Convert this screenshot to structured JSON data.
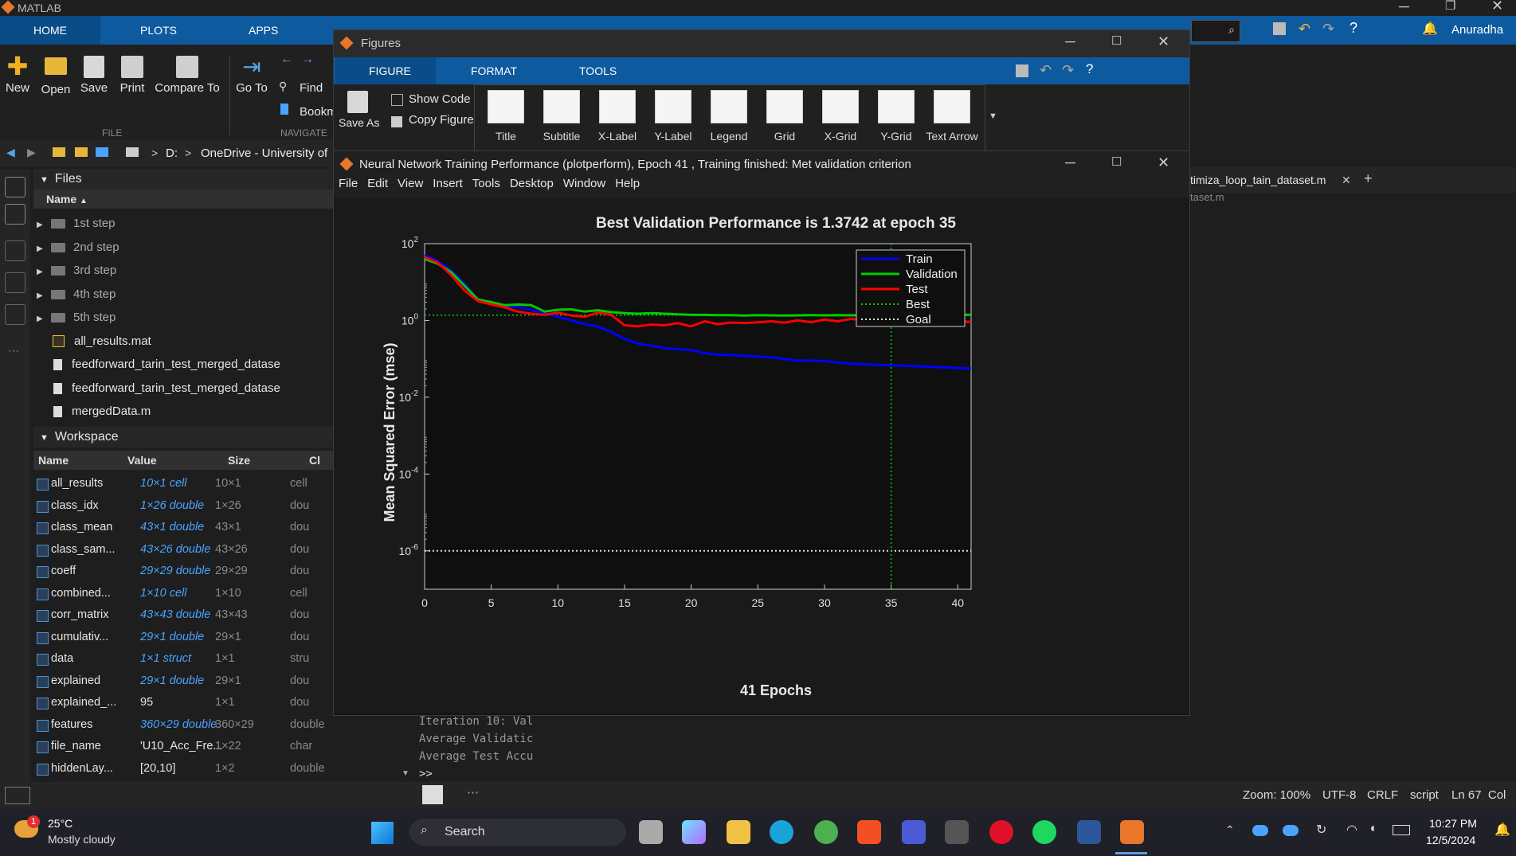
{
  "app_title": "MATLAB",
  "main_tabs": [
    "HOME",
    "PLOTS",
    "APPS"
  ],
  "user": "Anuradha",
  "toolstrip": {
    "file_buttons": [
      "New",
      "Open",
      "Save",
      "Print",
      "Compare To"
    ],
    "file_group": "FILE",
    "nav_buttons": [
      "Go To"
    ],
    "find_label": "Find",
    "bookmark_label": "Bookm",
    "nav_group": "NAVIGATE"
  },
  "address": {
    "drive": "D:",
    "sep": ">",
    "path": "OneDrive - University of"
  },
  "files_panel": {
    "title": "Files",
    "col_name": "Name",
    "items": [
      {
        "name": "1st step",
        "type": "folder"
      },
      {
        "name": "2nd step",
        "type": "folder"
      },
      {
        "name": "3rd step",
        "type": "folder"
      },
      {
        "name": "4th step",
        "type": "folder"
      },
      {
        "name": "5th step",
        "type": "folder"
      },
      {
        "name": "all_results.mat",
        "type": "mat"
      },
      {
        "name": "feedforward_tarin_test_merged_datase",
        "type": "file"
      },
      {
        "name": "feedforward_tarin_test_merged_datase",
        "type": "file"
      },
      {
        "name": "mergedData.m",
        "type": "file"
      }
    ]
  },
  "workspace": {
    "title": "Workspace",
    "headers": [
      "Name",
      "Value",
      "Size",
      "Cl"
    ],
    "rows": [
      {
        "name": "all_results",
        "value": "10×1 cell",
        "size": "10×1",
        "cls": "cell",
        "link": true
      },
      {
        "name": "class_idx",
        "value": "1×26 double",
        "size": "1×26",
        "cls": "dou",
        "link": true
      },
      {
        "name": "class_mean",
        "value": "43×1 double",
        "size": "43×1",
        "cls": "dou",
        "link": true
      },
      {
        "name": "class_sam...",
        "value": "43×26 double",
        "size": "43×26",
        "cls": "dou",
        "link": true
      },
      {
        "name": "coeff",
        "value": "29×29 double",
        "size": "29×29",
        "cls": "dou",
        "link": true
      },
      {
        "name": "combined...",
        "value": "1×10 cell",
        "size": "1×10",
        "cls": "cell",
        "link": true
      },
      {
        "name": "corr_matrix",
        "value": "43×43 double",
        "size": "43×43",
        "cls": "dou",
        "link": true
      },
      {
        "name": "cumulativ...",
        "value": "29×1 double",
        "size": "29×1",
        "cls": "dou",
        "link": true
      },
      {
        "name": "data",
        "value": "1×1 struct",
        "size": "1×1",
        "cls": "stru",
        "link": true
      },
      {
        "name": "explained",
        "value": "29×1 double",
        "size": "29×1",
        "cls": "dou",
        "link": true
      },
      {
        "name": "explained_...",
        "value": "95",
        "size": "1×1",
        "cls": "dou",
        "link": false
      },
      {
        "name": "features",
        "value": "360×29 double",
        "size": "360×29",
        "cls": "double",
        "link": true
      },
      {
        "name": "file_name",
        "value": "'U10_Acc_Fre...",
        "size": "1×22",
        "cls": "char",
        "link": false
      },
      {
        "name": "hiddenLay...",
        "value": "[20,10]",
        "size": "1×2",
        "cls": "double",
        "link": false
      }
    ]
  },
  "figures_window": {
    "title": "Figures",
    "tabs": [
      "FIGURE",
      "FORMAT",
      "TOOLS"
    ],
    "save_as": "Save As",
    "show_code": "Show Code",
    "copy_figure": "Copy Figure",
    "gallery": [
      "Title",
      "Subtitle",
      "X-Label",
      "Y-Label",
      "Legend",
      "Grid",
      "X-Grid",
      "Y-Grid",
      "Text Arrow"
    ]
  },
  "nn_window": {
    "title": "Neural Network Training Performance (plotperform), Epoch 41 , Training finished: Met validation criterion",
    "menu": [
      "File",
      "Edit",
      "View",
      "Insert",
      "Tools",
      "Desktop",
      "Window",
      "Help"
    ]
  },
  "chart_data": {
    "type": "line",
    "title": "Best Validation Performance is 1.3742 at epoch 35",
    "xlabel": "41 Epochs",
    "ylabel": "Mean Squared Error  (mse)",
    "yscale": "log",
    "xlim": [
      0,
      41
    ],
    "ylim": [
      1e-07,
      100
    ],
    "xticks": [
      "0",
      "5",
      "10",
      "15",
      "20",
      "25",
      "30",
      "35",
      "40"
    ],
    "yticks": [
      {
        "base": "10",
        "exp": "2"
      },
      {
        "base": "10",
        "exp": "0"
      },
      {
        "base": "10",
        "exp": "-2"
      },
      {
        "base": "10",
        "exp": "-4"
      },
      {
        "base": "10",
        "exp": "-6"
      }
    ],
    "legend_position": "top-right",
    "series": [
      {
        "name": "Train",
        "color": "#0000ff",
        "x": [
          0,
          1,
          2,
          3,
          4,
          5,
          6,
          7,
          8,
          9,
          10,
          11,
          12,
          13,
          14,
          15,
          16,
          17,
          18,
          19,
          20,
          21,
          22,
          23,
          24,
          25,
          26,
          27,
          28,
          29,
          30,
          31,
          32,
          33,
          34,
          35,
          36,
          37,
          38,
          39,
          40,
          41
        ],
        "y": [
          50,
          35,
          20,
          9,
          3.5,
          2.8,
          2.4,
          2.2,
          1.9,
          1.5,
          1.25,
          1.0,
          0.8,
          0.7,
          0.5,
          0.33,
          0.25,
          0.22,
          0.19,
          0.18,
          0.17,
          0.14,
          0.13,
          0.125,
          0.12,
          0.115,
          0.11,
          0.1,
          0.09,
          0.09,
          0.088,
          0.08,
          0.075,
          0.072,
          0.07,
          0.068,
          0.066,
          0.064,
          0.062,
          0.06,
          0.058,
          0.056
        ]
      },
      {
        "name": "Validation",
        "color": "#00cc00",
        "x": [
          0,
          1,
          2,
          3,
          4,
          5,
          6,
          7,
          8,
          9,
          10,
          11,
          12,
          13,
          14,
          15,
          16,
          17,
          18,
          19,
          20,
          21,
          22,
          23,
          24,
          25,
          26,
          27,
          28,
          29,
          30,
          31,
          32,
          33,
          34,
          35,
          36,
          37,
          38,
          39,
          40,
          41
        ],
        "y": [
          40,
          30,
          18,
          8,
          3.5,
          3.0,
          2.5,
          2.6,
          2.5,
          1.7,
          1.9,
          1.95,
          1.7,
          1.85,
          1.65,
          1.55,
          1.5,
          1.55,
          1.5,
          1.45,
          1.4,
          1.4,
          1.38,
          1.38,
          1.35,
          1.38,
          1.36,
          1.35,
          1.36,
          1.38,
          1.36,
          1.38,
          1.36,
          1.38,
          1.36,
          1.3742,
          1.4,
          1.38,
          1.4,
          1.38,
          1.4,
          1.4
        ]
      },
      {
        "name": "Test",
        "color": "#ff0000",
        "x": [
          0,
          1,
          2,
          3,
          4,
          5,
          6,
          7,
          8,
          9,
          10,
          11,
          12,
          13,
          14,
          15,
          16,
          17,
          18,
          19,
          20,
          21,
          22,
          23,
          24,
          25,
          26,
          27,
          28,
          29,
          30,
          31,
          32,
          33,
          34,
          35,
          36,
          37,
          38,
          39,
          40,
          41
        ],
        "y": [
          45,
          32,
          15,
          6,
          3.2,
          2.6,
          2.2,
          1.7,
          1.5,
          1.4,
          1.6,
          1.35,
          1.25,
          1.6,
          1.4,
          0.75,
          0.7,
          0.78,
          0.75,
          0.85,
          0.7,
          0.95,
          0.8,
          0.88,
          0.85,
          0.9,
          0.95,
          0.88,
          1.0,
          0.9,
          1.05,
          0.95,
          1.1,
          1.0,
          0.95,
          1.0,
          1.05,
          1.0,
          1.05,
          1.0,
          0.95,
          0.92
        ]
      }
    ],
    "best": {
      "name": "Best",
      "epoch": 35,
      "value": 1.3742,
      "color": "#00cc00"
    },
    "goal": {
      "name": "Goal",
      "value": 1e-06,
      "color": "#e0e0e0"
    }
  },
  "editor": {
    "tab_label": "timiza_loop_tain_dataset.m",
    "subpath": "taset.m"
  },
  "command_window": {
    "lines": [
      "Iteration 10: Val",
      "Average Validatic",
      "Average Test Accu"
    ],
    "prompt": ">>"
  },
  "status_bar": {
    "zoom": "Zoom: 100%",
    "encoding": "UTF-8",
    "line_ending": "CRLF",
    "mode": "script",
    "position": "Ln 67  Col"
  },
  "taskbar": {
    "weather_temp": "25°C",
    "weather_desc": "Mostly cloudy",
    "weather_badge": "1",
    "search_label": "Search",
    "time": "10:27 PM",
    "date": "12/5/2024"
  }
}
